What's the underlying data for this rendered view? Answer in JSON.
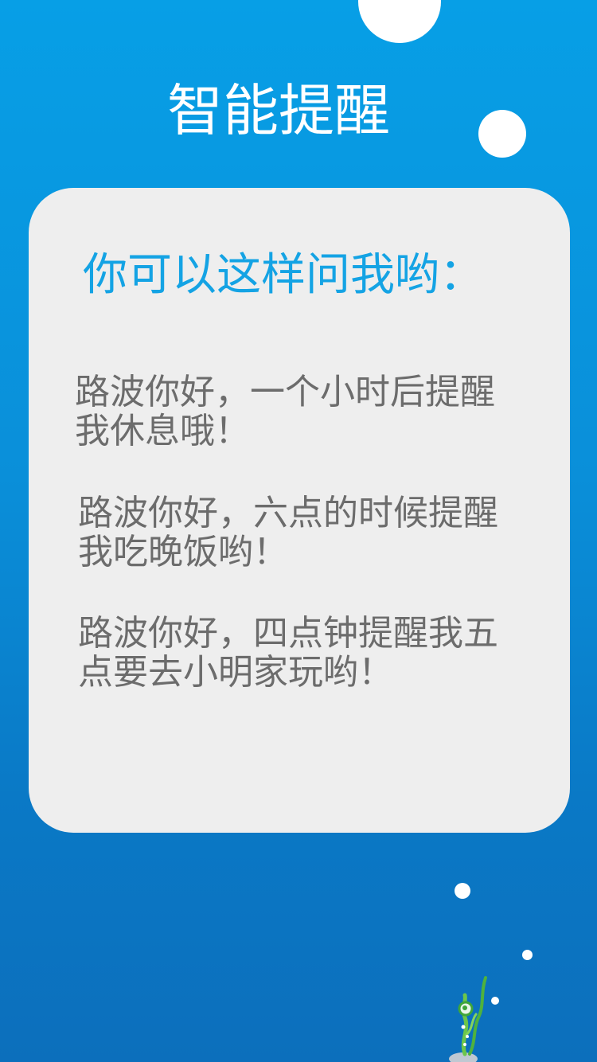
{
  "page": {
    "title": "智能提醒"
  },
  "card": {
    "heading": "你可以这样问我哟：",
    "examples": [
      "路波你好，一个小时后提醒我休息哦！",
      "路波你好，六点的时候提醒我吃晚饭哟！",
      "路波你好，四点钟提醒我五点要去小明家玩哟！"
    ]
  },
  "decorations": {
    "bubbles": "bubble-icon",
    "seaweed": "seaweed-icon"
  },
  "colors": {
    "background_top": "#079fe6",
    "background_bottom": "#0c6fbc",
    "card": "#eeeeee",
    "heading": "#14a3e4",
    "body_text": "#6c6c6c"
  }
}
